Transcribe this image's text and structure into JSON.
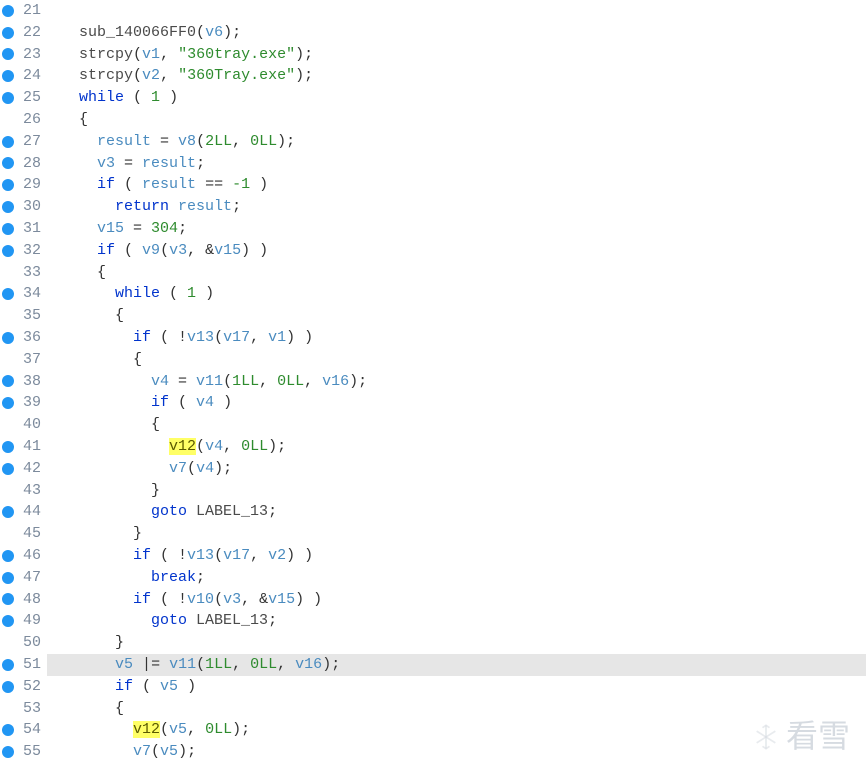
{
  "lines": [
    {
      "n": 21,
      "bp": true,
      "segs": []
    },
    {
      "n": 22,
      "bp": true,
      "segs": [
        {
          "t": "  ",
          "c": ""
        },
        {
          "t": "sub_140066FF0",
          "c": "fn"
        },
        {
          "t": "(",
          "c": "br"
        },
        {
          "t": "v6",
          "c": "var"
        },
        {
          "t": ");",
          "c": "op"
        }
      ]
    },
    {
      "n": 23,
      "bp": true,
      "segs": [
        {
          "t": "  ",
          "c": ""
        },
        {
          "t": "strcpy",
          "c": "fn"
        },
        {
          "t": "(",
          "c": "br"
        },
        {
          "t": "v1",
          "c": "var"
        },
        {
          "t": ", ",
          "c": "op"
        },
        {
          "t": "\"360tray.exe\"",
          "c": "str"
        },
        {
          "t": ");",
          "c": "op"
        }
      ]
    },
    {
      "n": 24,
      "bp": true,
      "segs": [
        {
          "t": "  ",
          "c": ""
        },
        {
          "t": "strcpy",
          "c": "fn"
        },
        {
          "t": "(",
          "c": "br"
        },
        {
          "t": "v2",
          "c": "var"
        },
        {
          "t": ", ",
          "c": "op"
        },
        {
          "t": "\"360Tray.exe\"",
          "c": "str"
        },
        {
          "t": ");",
          "c": "op"
        }
      ]
    },
    {
      "n": 25,
      "bp": true,
      "segs": [
        {
          "t": "  ",
          "c": ""
        },
        {
          "t": "while",
          "c": "kw"
        },
        {
          "t": " ( ",
          "c": "op"
        },
        {
          "t": "1",
          "c": "num"
        },
        {
          "t": " )",
          "c": "op"
        }
      ]
    },
    {
      "n": 26,
      "bp": false,
      "segs": [
        {
          "t": "  {",
          "c": "br"
        }
      ]
    },
    {
      "n": 27,
      "bp": true,
      "segs": [
        {
          "t": "    ",
          "c": ""
        },
        {
          "t": "result",
          "c": "var"
        },
        {
          "t": " = ",
          "c": "op"
        },
        {
          "t": "v8",
          "c": "var"
        },
        {
          "t": "(",
          "c": "br"
        },
        {
          "t": "2LL",
          "c": "num"
        },
        {
          "t": ", ",
          "c": "op"
        },
        {
          "t": "0LL",
          "c": "num"
        },
        {
          "t": ");",
          "c": "op"
        }
      ]
    },
    {
      "n": 28,
      "bp": true,
      "segs": [
        {
          "t": "    ",
          "c": ""
        },
        {
          "t": "v3",
          "c": "var"
        },
        {
          "t": " = ",
          "c": "op"
        },
        {
          "t": "result",
          "c": "var"
        },
        {
          "t": ";",
          "c": "op"
        }
      ]
    },
    {
      "n": 29,
      "bp": true,
      "segs": [
        {
          "t": "    ",
          "c": ""
        },
        {
          "t": "if",
          "c": "kw"
        },
        {
          "t": " ( ",
          "c": "op"
        },
        {
          "t": "result",
          "c": "var"
        },
        {
          "t": " == ",
          "c": "op"
        },
        {
          "t": "-1",
          "c": "num"
        },
        {
          "t": " )",
          "c": "op"
        }
      ]
    },
    {
      "n": 30,
      "bp": true,
      "segs": [
        {
          "t": "      ",
          "c": ""
        },
        {
          "t": "return",
          "c": "kw"
        },
        {
          "t": " ",
          "c": ""
        },
        {
          "t": "result",
          "c": "var"
        },
        {
          "t": ";",
          "c": "op"
        }
      ]
    },
    {
      "n": 31,
      "bp": true,
      "segs": [
        {
          "t": "    ",
          "c": ""
        },
        {
          "t": "v15",
          "c": "var"
        },
        {
          "t": " = ",
          "c": "op"
        },
        {
          "t": "304",
          "c": "num"
        },
        {
          "t": ";",
          "c": "op"
        }
      ]
    },
    {
      "n": 32,
      "bp": true,
      "segs": [
        {
          "t": "    ",
          "c": ""
        },
        {
          "t": "if",
          "c": "kw"
        },
        {
          "t": " ( ",
          "c": "op"
        },
        {
          "t": "v9",
          "c": "var"
        },
        {
          "t": "(",
          "c": "br"
        },
        {
          "t": "v3",
          "c": "var"
        },
        {
          "t": ", &",
          "c": "op"
        },
        {
          "t": "v15",
          "c": "var"
        },
        {
          "t": ") )",
          "c": "op"
        }
      ]
    },
    {
      "n": 33,
      "bp": false,
      "segs": [
        {
          "t": "    {",
          "c": "br"
        }
      ]
    },
    {
      "n": 34,
      "bp": true,
      "segs": [
        {
          "t": "      ",
          "c": ""
        },
        {
          "t": "while",
          "c": "kw"
        },
        {
          "t": " ( ",
          "c": "op"
        },
        {
          "t": "1",
          "c": "num"
        },
        {
          "t": " )",
          "c": "op"
        }
      ]
    },
    {
      "n": 35,
      "bp": false,
      "segs": [
        {
          "t": "      {",
          "c": "br"
        }
      ]
    },
    {
      "n": 36,
      "bp": true,
      "segs": [
        {
          "t": "        ",
          "c": ""
        },
        {
          "t": "if",
          "c": "kw"
        },
        {
          "t": " ( !",
          "c": "op"
        },
        {
          "t": "v13",
          "c": "var"
        },
        {
          "t": "(",
          "c": "br"
        },
        {
          "t": "v17",
          "c": "var"
        },
        {
          "t": ", ",
          "c": "op"
        },
        {
          "t": "v1",
          "c": "var"
        },
        {
          "t": ") )",
          "c": "op"
        }
      ]
    },
    {
      "n": 37,
      "bp": false,
      "segs": [
        {
          "t": "        {",
          "c": "br"
        }
      ]
    },
    {
      "n": 38,
      "bp": true,
      "segs": [
        {
          "t": "          ",
          "c": ""
        },
        {
          "t": "v4",
          "c": "var"
        },
        {
          "t": " = ",
          "c": "op"
        },
        {
          "t": "v11",
          "c": "var"
        },
        {
          "t": "(",
          "c": "br"
        },
        {
          "t": "1LL",
          "c": "num"
        },
        {
          "t": ", ",
          "c": "op"
        },
        {
          "t": "0LL",
          "c": "num"
        },
        {
          "t": ", ",
          "c": "op"
        },
        {
          "t": "v16",
          "c": "var"
        },
        {
          "t": ");",
          "c": "op"
        }
      ]
    },
    {
      "n": 39,
      "bp": true,
      "segs": [
        {
          "t": "          ",
          "c": ""
        },
        {
          "t": "if",
          "c": "kw"
        },
        {
          "t": " ( ",
          "c": "op"
        },
        {
          "t": "v4",
          "c": "var"
        },
        {
          "t": " )",
          "c": "op"
        }
      ]
    },
    {
      "n": 40,
      "bp": false,
      "segs": [
        {
          "t": "          {",
          "c": "br"
        }
      ]
    },
    {
      "n": 41,
      "bp": true,
      "segs": [
        {
          "t": "            ",
          "c": ""
        },
        {
          "t": "v12",
          "c": "hl"
        },
        {
          "t": "(",
          "c": "br"
        },
        {
          "t": "v4",
          "c": "var"
        },
        {
          "t": ", ",
          "c": "op"
        },
        {
          "t": "0LL",
          "c": "num"
        },
        {
          "t": ");",
          "c": "op"
        }
      ]
    },
    {
      "n": 42,
      "bp": true,
      "segs": [
        {
          "t": "            ",
          "c": ""
        },
        {
          "t": "v7",
          "c": "var"
        },
        {
          "t": "(",
          "c": "br"
        },
        {
          "t": "v4",
          "c": "var"
        },
        {
          "t": ");",
          "c": "op"
        }
      ]
    },
    {
      "n": 43,
      "bp": false,
      "segs": [
        {
          "t": "          }",
          "c": "br"
        }
      ]
    },
    {
      "n": 44,
      "bp": true,
      "segs": [
        {
          "t": "          ",
          "c": ""
        },
        {
          "t": "goto",
          "c": "kw"
        },
        {
          "t": " ",
          "c": ""
        },
        {
          "t": "LABEL_13",
          "c": "label"
        },
        {
          "t": ";",
          "c": "op"
        }
      ]
    },
    {
      "n": 45,
      "bp": false,
      "segs": [
        {
          "t": "        }",
          "c": "br"
        }
      ]
    },
    {
      "n": 46,
      "bp": true,
      "segs": [
        {
          "t": "        ",
          "c": ""
        },
        {
          "t": "if",
          "c": "kw"
        },
        {
          "t": " ( !",
          "c": "op"
        },
        {
          "t": "v13",
          "c": "var"
        },
        {
          "t": "(",
          "c": "br"
        },
        {
          "t": "v17",
          "c": "var"
        },
        {
          "t": ", ",
          "c": "op"
        },
        {
          "t": "v2",
          "c": "var"
        },
        {
          "t": ") )",
          "c": "op"
        }
      ]
    },
    {
      "n": 47,
      "bp": true,
      "segs": [
        {
          "t": "          ",
          "c": ""
        },
        {
          "t": "break",
          "c": "kw"
        },
        {
          "t": ";",
          "c": "op"
        }
      ]
    },
    {
      "n": 48,
      "bp": true,
      "segs": [
        {
          "t": "        ",
          "c": ""
        },
        {
          "t": "if",
          "c": "kw"
        },
        {
          "t": " ( !",
          "c": "op"
        },
        {
          "t": "v10",
          "c": "var"
        },
        {
          "t": "(",
          "c": "br"
        },
        {
          "t": "v3",
          "c": "var"
        },
        {
          "t": ", &",
          "c": "op"
        },
        {
          "t": "v15",
          "c": "var"
        },
        {
          "t": ") )",
          "c": "op"
        }
      ]
    },
    {
      "n": 49,
      "bp": true,
      "segs": [
        {
          "t": "          ",
          "c": ""
        },
        {
          "t": "goto",
          "c": "kw"
        },
        {
          "t": " ",
          "c": ""
        },
        {
          "t": "LABEL_13",
          "c": "label"
        },
        {
          "t": ";",
          "c": "op"
        }
      ]
    },
    {
      "n": 50,
      "bp": false,
      "segs": [
        {
          "t": "      }",
          "c": "br"
        }
      ]
    },
    {
      "n": 51,
      "bp": true,
      "cursor": true,
      "segs": [
        {
          "t": "      ",
          "c": ""
        },
        {
          "t": "v5",
          "c": "var"
        },
        {
          "t": " ",
          "c": ""
        },
        {
          "t": "|",
          "c": "op"
        },
        {
          "t": "= ",
          "c": "op"
        },
        {
          "t": "v11",
          "c": "var"
        },
        {
          "t": "(",
          "c": "br"
        },
        {
          "t": "1LL",
          "c": "num"
        },
        {
          "t": ", ",
          "c": "op"
        },
        {
          "t": "0LL",
          "c": "num"
        },
        {
          "t": ", ",
          "c": "op"
        },
        {
          "t": "v16",
          "c": "var"
        },
        {
          "t": ");",
          "c": "op"
        }
      ]
    },
    {
      "n": 52,
      "bp": true,
      "segs": [
        {
          "t": "      ",
          "c": ""
        },
        {
          "t": "if",
          "c": "kw"
        },
        {
          "t": " ( ",
          "c": "op"
        },
        {
          "t": "v5",
          "c": "var"
        },
        {
          "t": " )",
          "c": "op"
        }
      ]
    },
    {
      "n": 53,
      "bp": false,
      "segs": [
        {
          "t": "      {",
          "c": "br"
        }
      ]
    },
    {
      "n": 54,
      "bp": true,
      "segs": [
        {
          "t": "        ",
          "c": ""
        },
        {
          "t": "v12",
          "c": "hl"
        },
        {
          "t": "(",
          "c": "br"
        },
        {
          "t": "v5",
          "c": "var"
        },
        {
          "t": ", ",
          "c": "op"
        },
        {
          "t": "0LL",
          "c": "num"
        },
        {
          "t": ");",
          "c": "op"
        }
      ]
    },
    {
      "n": 55,
      "bp": true,
      "segs": [
        {
          "t": "        ",
          "c": ""
        },
        {
          "t": "v7",
          "c": "var"
        },
        {
          "t": "(",
          "c": "br"
        },
        {
          "t": "v5",
          "c": "var"
        },
        {
          "t": ");",
          "c": "op"
        }
      ]
    }
  ],
  "watermark": "看雪"
}
